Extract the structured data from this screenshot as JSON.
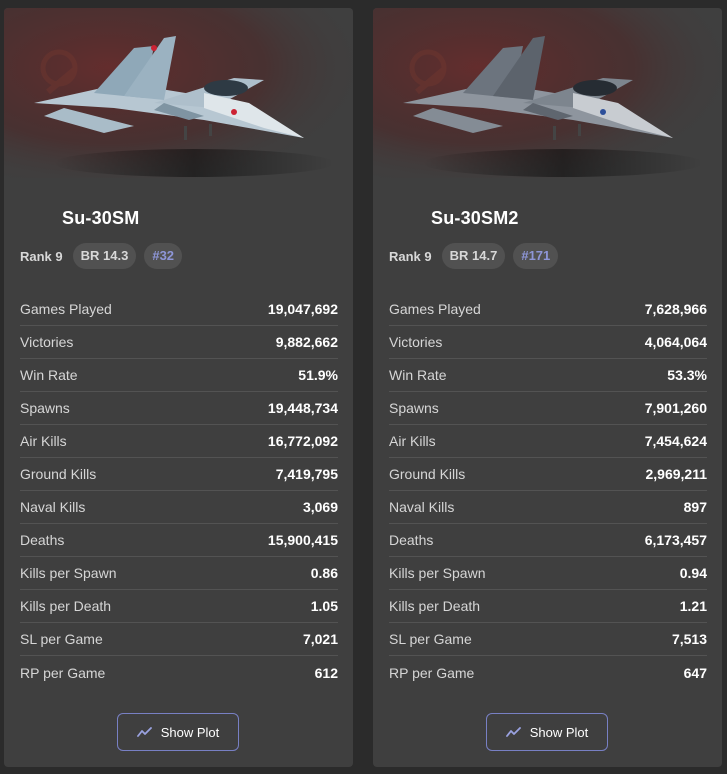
{
  "vehicles": [
    {
      "name": "Su-30SM",
      "rank": "Rank 9",
      "br": "BR 14.3",
      "position": "#32",
      "stats": [
        {
          "label": "Games Played",
          "value": "19,047,692"
        },
        {
          "label": "Victories",
          "value": "9,882,662"
        },
        {
          "label": "Win Rate",
          "value": "51.9%"
        },
        {
          "label": "Spawns",
          "value": "19,448,734"
        },
        {
          "label": "Air Kills",
          "value": "16,772,092"
        },
        {
          "label": "Ground Kills",
          "value": "7,419,795"
        },
        {
          "label": "Naval Kills",
          "value": "3,069"
        },
        {
          "label": "Deaths",
          "value": "15,900,415"
        },
        {
          "label": "Kills per Spawn",
          "value": "0.86"
        },
        {
          "label": "Kills per Death",
          "value": "1.05"
        },
        {
          "label": "SL per Game",
          "value": "7,021"
        },
        {
          "label": "RP per Game",
          "value": "612"
        }
      ],
      "button_label": "Show Plot",
      "camo": "#9fb6c6"
    },
    {
      "name": "Su-30SM2",
      "rank": "Rank 9",
      "br": "BR 14.7",
      "position": "#171",
      "stats": [
        {
          "label": "Games Played",
          "value": "7,628,966"
        },
        {
          "label": "Victories",
          "value": "4,064,064"
        },
        {
          "label": "Win Rate",
          "value": "53.3%"
        },
        {
          "label": "Spawns",
          "value": "7,901,260"
        },
        {
          "label": "Air Kills",
          "value": "7,454,624"
        },
        {
          "label": "Ground Kills",
          "value": "2,969,211"
        },
        {
          "label": "Naval Kills",
          "value": "897"
        },
        {
          "label": "Deaths",
          "value": "6,173,457"
        },
        {
          "label": "Kills per Spawn",
          "value": "0.94"
        },
        {
          "label": "Kills per Death",
          "value": "1.21"
        },
        {
          "label": "SL per Game",
          "value": "7,513"
        },
        {
          "label": "RP per Game",
          "value": "647"
        }
      ],
      "button_label": "Show Plot",
      "camo": "#8a929c"
    }
  ],
  "colors": {
    "page_bg": "#2b2b2b",
    "card_bg": "#3f3f3f",
    "badge_bg": "#515151",
    "position_text": "#8e96d8",
    "button_border": "#7880c4",
    "flag_red": "#5e2424"
  },
  "icons": {
    "hero": "aircraft-image",
    "flag": "soviet-flag-emblem",
    "button": "line-chart-icon"
  }
}
